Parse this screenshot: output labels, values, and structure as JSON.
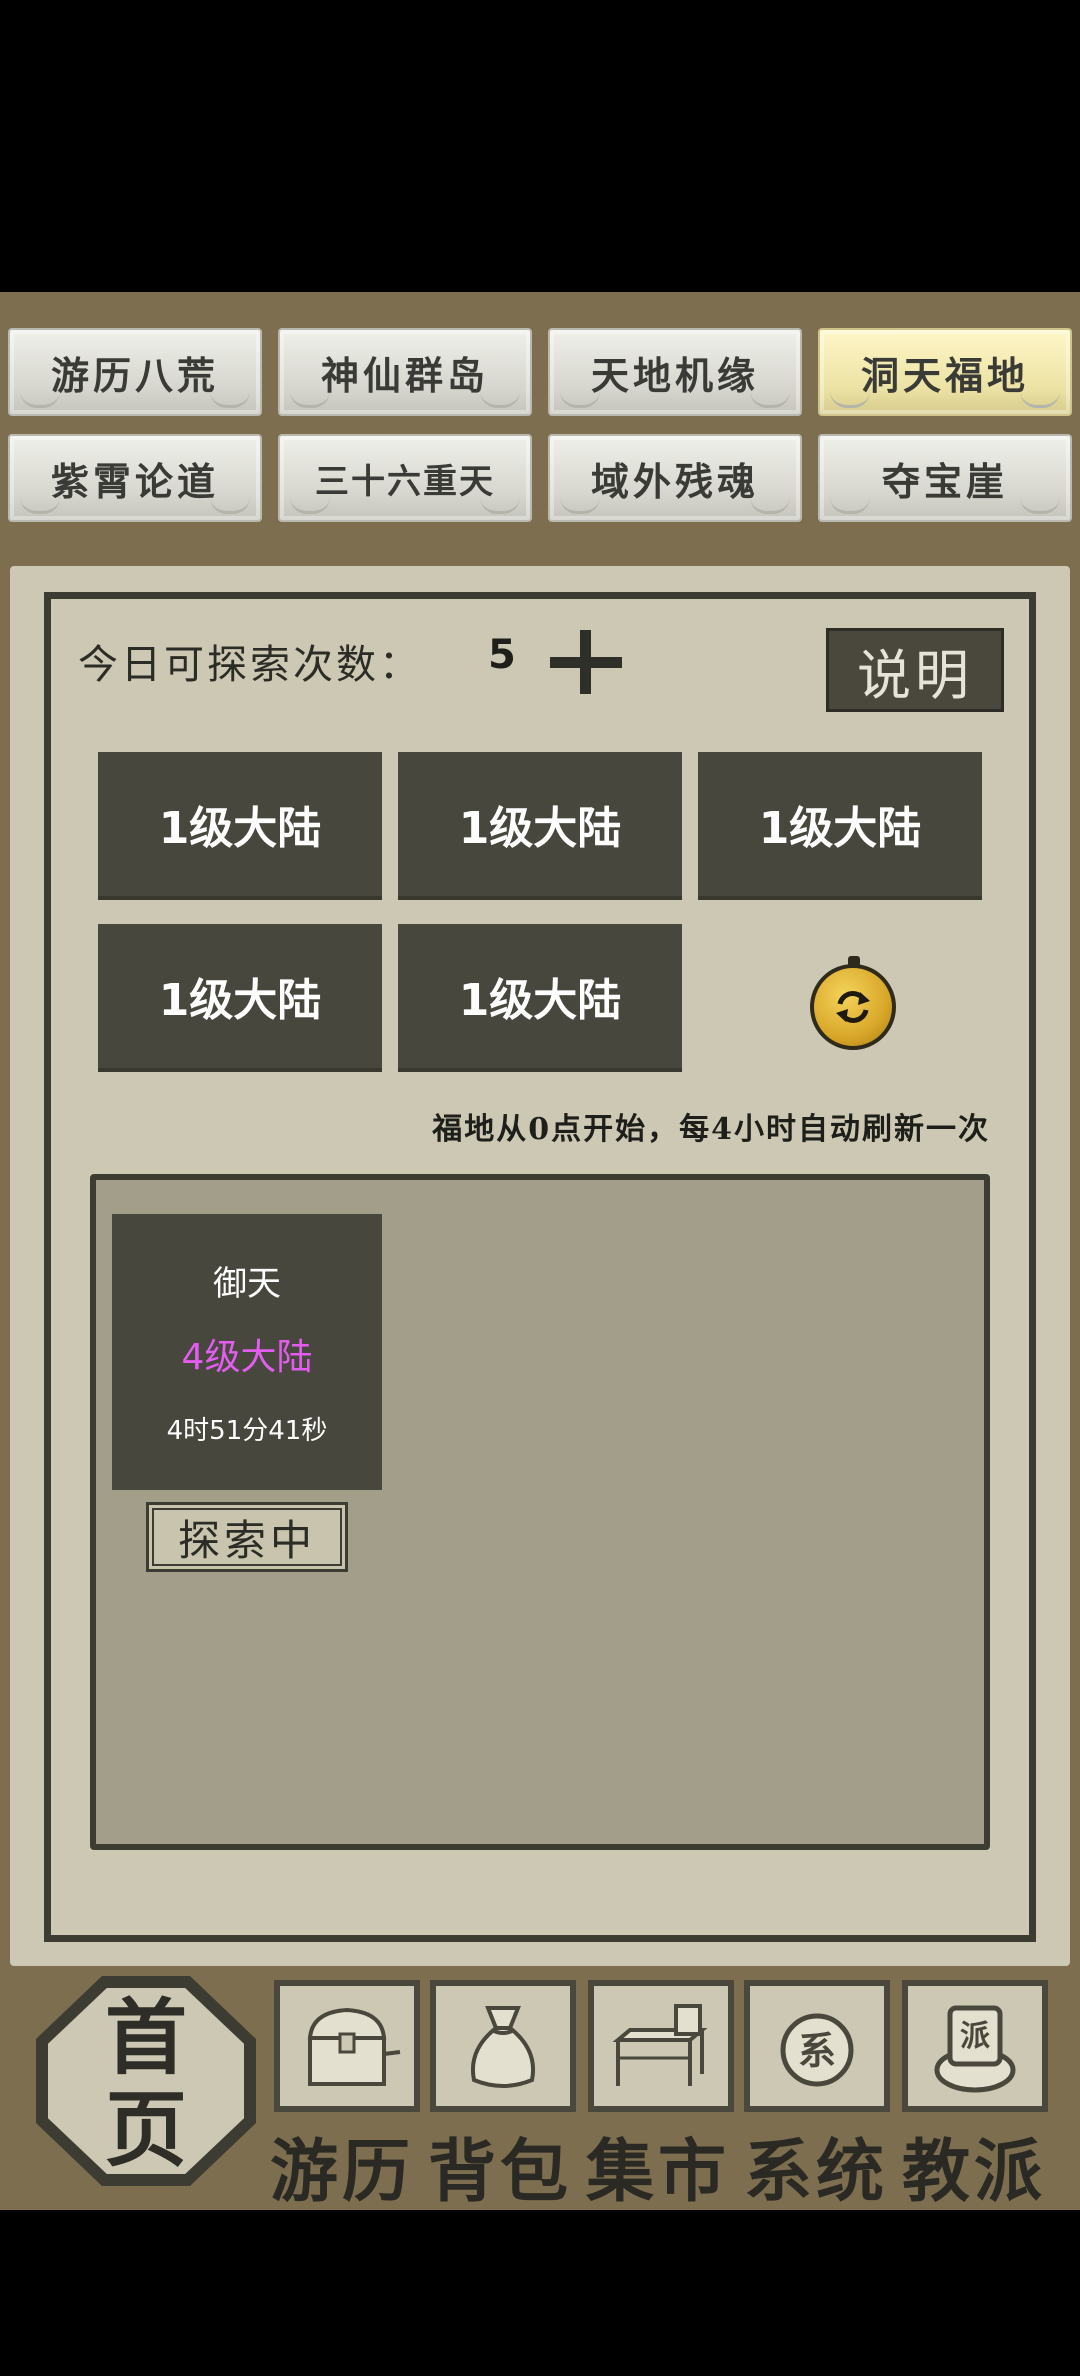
{
  "tabs": [
    {
      "label": "游历八荒",
      "active": false
    },
    {
      "label": "神仙群岛",
      "active": false
    },
    {
      "label": "天地机缘",
      "active": false
    },
    {
      "label": "洞天福地",
      "active": true
    },
    {
      "label": "紫霄论道",
      "active": false
    },
    {
      "label": "三十六重天",
      "active": false
    },
    {
      "label": "域外残魂",
      "active": false
    },
    {
      "label": "夺宝崖",
      "active": false
    }
  ],
  "explore": {
    "count_label": "今日可探索次数：",
    "count_value": "5",
    "help_label": "说明",
    "lands": [
      "1级大陆",
      "1级大陆",
      "1级大陆",
      "1级大陆",
      "1级大陆"
    ],
    "refresh_note": "福地从0点开始，每4小时自动刷新一次"
  },
  "card": {
    "name": "御天",
    "level": "4级大陆",
    "timer": "4时51分41秒",
    "status": "探索中"
  },
  "nav": {
    "home": "首页",
    "items": [
      "游历",
      "背包",
      "集市",
      "系统",
      "教派"
    ]
  },
  "colors": {
    "frame_brown": "#7c6e4f",
    "panel_beige": "#cdc8b3",
    "dark_tile": "#48473d",
    "level_purple": "#e25cf0",
    "active_tab": "#ece2a4"
  }
}
